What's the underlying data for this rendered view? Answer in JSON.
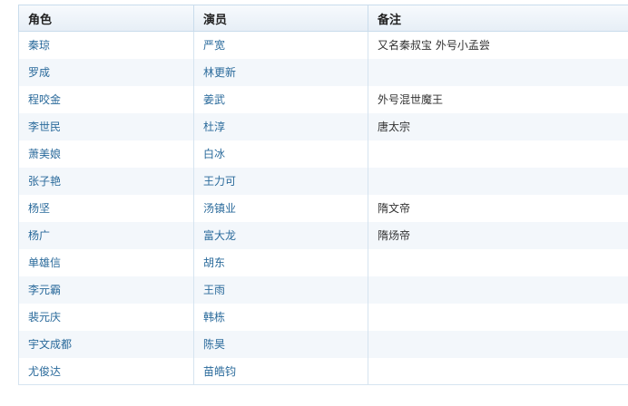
{
  "table": {
    "headers": [
      "角色",
      "演员",
      "备注"
    ],
    "rows": [
      {
        "role": "秦琼",
        "actor": "严宽",
        "note": "又名秦叔宝 外号小孟尝"
      },
      {
        "role": "罗成",
        "actor": "林更新",
        "note": ""
      },
      {
        "role": "程咬金",
        "actor": "姜武",
        "note": "外号混世魔王"
      },
      {
        "role": "李世民",
        "actor": "杜淳",
        "note": "唐太宗"
      },
      {
        "role": "萧美娘",
        "actor": "白冰",
        "note": ""
      },
      {
        "role": "张子艳",
        "actor": "王力可",
        "note": ""
      },
      {
        "role": "杨坚",
        "actor": "汤镇业",
        "note": "隋文帝"
      },
      {
        "role": "杨广",
        "actor": "富大龙",
        "note": "隋炀帝"
      },
      {
        "role": "单雄信",
        "actor": "胡东",
        "note": ""
      },
      {
        "role": "李元霸",
        "actor": "王雨",
        "note": ""
      },
      {
        "role": "裴元庆",
        "actor": "韩栋",
        "note": ""
      },
      {
        "role": "宇文成都",
        "actor": "陈昊",
        "note": ""
      },
      {
        "role": "尤俊达",
        "actor": "苗皓钧",
        "note": ""
      }
    ]
  }
}
